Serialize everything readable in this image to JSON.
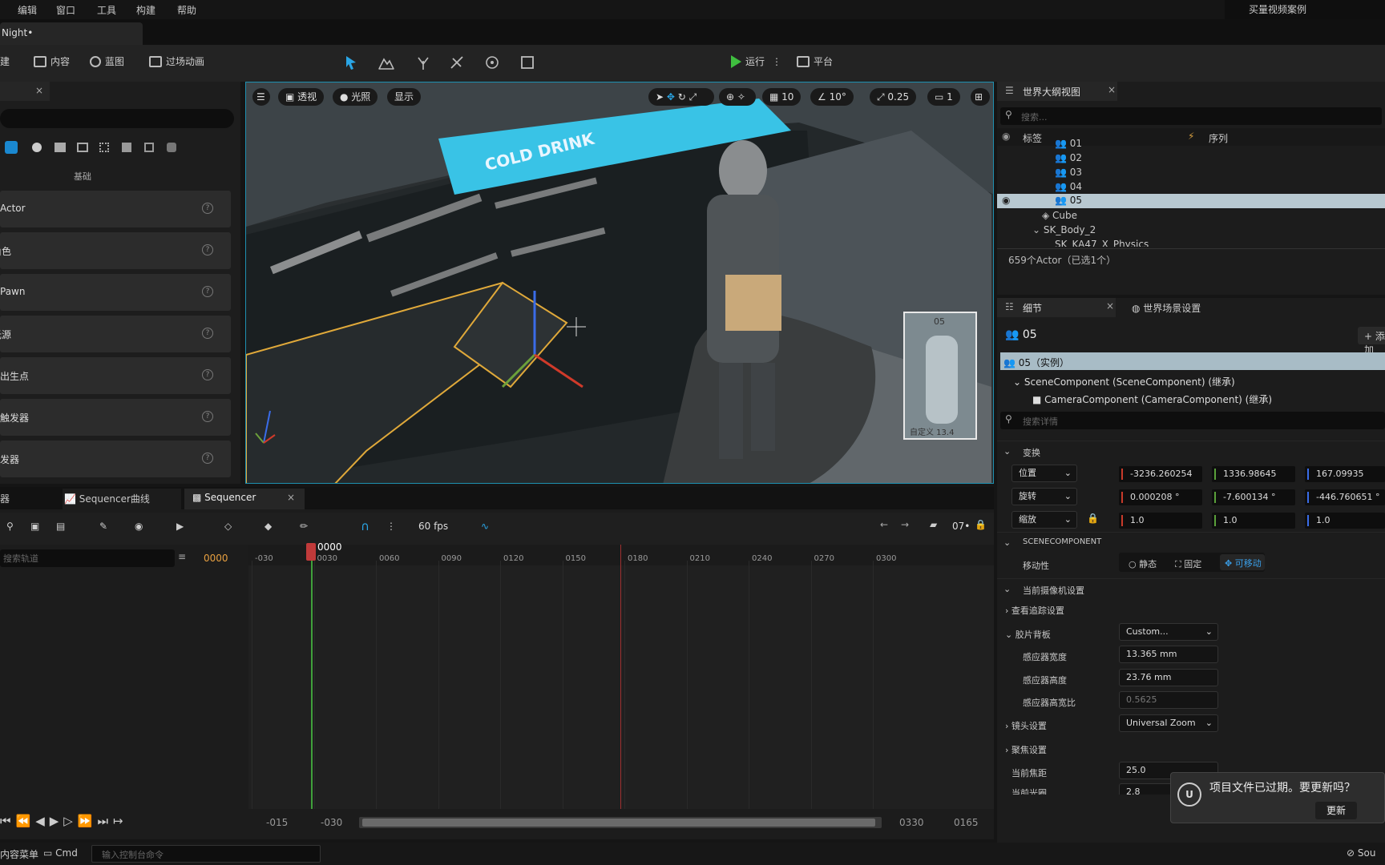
{
  "menubar": {
    "items": [
      "编辑",
      "窗口",
      "工具",
      "构建",
      "帮助"
    ],
    "promo": "买量视频案例"
  },
  "doc_tab": "Night•",
  "toolbar": {
    "create": "创建",
    "content": "内容",
    "blueprint": "蓝图",
    "cinematics": "过场动画",
    "run": "运行",
    "platform": "平台"
  },
  "left_panel": {
    "category": "基础",
    "items": [
      "Actor",
      "角色",
      "Pawn",
      "光源",
      "玩家出生点",
      "立方体触发器",
      "球体触发器"
    ]
  },
  "viewport": {
    "perspective": "透视",
    "lit": "光照",
    "show": "显示",
    "grid_snap": "10",
    "rot_snap": "10°",
    "scale_snap": "0.25",
    "cam_speed": "1",
    "preview_label": "05",
    "preview_caption": "自定义 13.4",
    "sign_text": "COLD DRINK"
  },
  "outliner": {
    "title": "世界大纲视图",
    "search_placeholder": "搜索...",
    "col_label": "标签",
    "col_seq": "序列",
    "items": [
      "01",
      "02",
      "03",
      "04",
      "05",
      "Cube",
      "SK_Body_2",
      "SK_KA47_X_Physics"
    ],
    "selected": "05",
    "count": "659个Actor（已选1个）"
  },
  "details": {
    "tab_details": "细节",
    "tab_world": "世界场景设置",
    "actor": "05",
    "add": "添加",
    "instance": "05（实例）",
    "comp1": "SceneComponent (SceneComponent) (继承)",
    "comp2": "CameraComponent (CameraComponent) (继承)",
    "search_placeholder": "搜索详情",
    "transform": "变换",
    "location_label": "位置",
    "loc": [
      "-3236.260254",
      "1336.98645",
      "167.09935"
    ],
    "rotation_label": "旋转",
    "rot": [
      "0.000208 °",
      "-7.600134 °",
      "-446.760651 °"
    ],
    "scale_label": "缩放",
    "scale": [
      "1.0",
      "1.0",
      "1.0"
    ],
    "scenecomponent": "SCENECOMPONENT",
    "mobility": "移动性",
    "mob_static": "静态",
    "mob_stationary": "固定",
    "mob_movable": "可移动",
    "camera_settings": "当前摄像机设置",
    "lookat": "查看追踪设置",
    "filmback": "胶片背板",
    "filmback_val": "Custom...",
    "sensor_w_label": "感应器宽度",
    "sensor_w": "13.365 mm",
    "sensor_h_label": "感应器高度",
    "sensor_h": "23.76 mm",
    "aspect_label": "感应器高宽比",
    "aspect": "0.5625",
    "lens_label": "镜头设置",
    "lens_val": "Universal Zoom",
    "focus_label": "聚焦设置",
    "focal_label": "当前焦距",
    "focal": "25.0",
    "aperture_label": "当前光圈",
    "aperture": "2.8"
  },
  "sequencer": {
    "tab_prev": "器",
    "tab_curve": "Sequencer曲线",
    "tab_seq": "Sequencer",
    "fps": "60 fps",
    "search_placeholder": "搜索轨道",
    "frame": "0000",
    "playhead": "0000",
    "end_frame_btn": "07•",
    "ticks": [
      "-030",
      "0030",
      "0060",
      "0090",
      "0120",
      "0150",
      "0180",
      "0210",
      "0240",
      "0270",
      "0300"
    ],
    "range_start": "-015",
    "range_view_start": "-030",
    "range_view_end": "0330",
    "range_end": "0165"
  },
  "statusbar": {
    "menu": "内容菜单",
    "cmd": "Cmd",
    "console_placeholder": "输入控制台命令",
    "source": "Sou"
  },
  "toast": {
    "message": "项目文件已过期。要更新吗？",
    "button": "更新"
  }
}
